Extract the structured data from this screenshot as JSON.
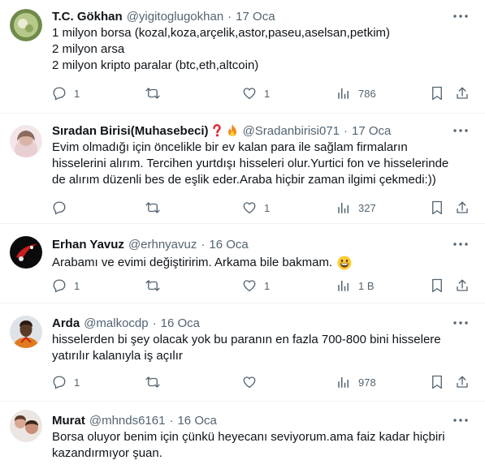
{
  "tweets": [
    {
      "name": "T.C. Gökhan",
      "handle": "@yigitoglugokhan",
      "date": "17 Oca",
      "lines": [
        "1 milyon borsa (kozal,koza,arçelik,astor,paseu,aselsan,petkim)",
        "2 milyon arsa",
        "2 milyon kripto paralar (btc,eth,altcoin)"
      ],
      "replies": "1",
      "retweets": "",
      "likes": "1",
      "views": "786"
    },
    {
      "name": "Sıradan Birisi(Muhasebeci)",
      "handle": "@Sradanbirisi071",
      "date": "17 Oca",
      "name_emojis": [
        "red-question-mark",
        "fire"
      ],
      "lines": [
        "Evim olmadığı için öncelikle bir ev kalan para ile sağlam firmaların",
        "hisselerini alırım. Tercihen yurtdışı hisseleri olur.Yurtici fon ve hisselerinde",
        "de alırım düzenli bes de eşlik eder.Araba hiçbir zaman ilgimi çekmedi:))"
      ],
      "replies": "",
      "retweets": "",
      "likes": "1",
      "views": "327"
    },
    {
      "name": "Erhan Yavuz",
      "handle": "@erhnyavuz",
      "date": "16 Oca",
      "lines": [
        "Arabamı ve evimi değiştiririm. Arkama bile bakmam."
      ],
      "body_emoji": "grinning-face",
      "replies": "1",
      "retweets": "",
      "likes": "1",
      "views": "1 B"
    },
    {
      "name": "Arda",
      "handle": "@malkocdp",
      "date": "16 Oca",
      "lines": [
        "hisselerden bi şey olacak yok bu paranın en fazla 700-800 bini hisselere",
        "yatırılır kalanıyla iş açılır"
      ],
      "replies": "1",
      "retweets": "",
      "likes": "",
      "views": "978"
    },
    {
      "name": "Murat",
      "handle": "@mhnds6161",
      "date": "16 Oca",
      "lines": [
        "Borsa oluyor benim için çünkü heyecanı seviyorum.ama faiz kadar hiçbiri",
        "kazandırmıyor şuan."
      ]
    }
  ],
  "colors": {
    "text": "#0f1419",
    "secondary": "#536471",
    "divider": "#eff3f4"
  }
}
